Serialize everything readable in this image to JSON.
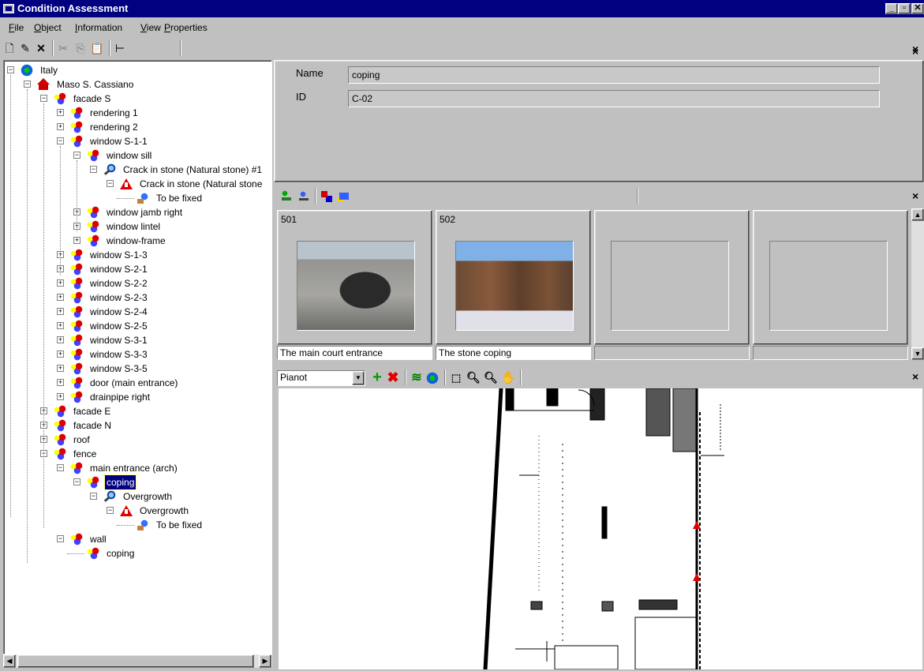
{
  "window": {
    "title": "Condition Assessment"
  },
  "menu": [
    "File",
    "Object",
    "Information",
    "View",
    "Properties"
  ],
  "tree": [
    {
      "label": "Italy",
      "icon": "globe-icon",
      "depth": 0,
      "expander": "minus"
    },
    {
      "label": "Maso S. Cassiano",
      "icon": "house-icon",
      "depth": 1,
      "expander": "minus"
    },
    {
      "label": "facade S",
      "icon": "object-icon",
      "depth": 2,
      "expander": "minus"
    },
    {
      "label": "rendering 1",
      "icon": "object-icon",
      "depth": 3,
      "expander": "plus"
    },
    {
      "label": "rendering 2",
      "icon": "object-icon",
      "depth": 3,
      "expander": "plus"
    },
    {
      "label": "window S-1-1",
      "icon": "object-icon",
      "depth": 3,
      "expander": "minus"
    },
    {
      "label": "window sill",
      "icon": "object-icon",
      "depth": 4,
      "expander": "minus"
    },
    {
      "label": "Crack in stone (Natural stone) #1",
      "icon": "magnifier-icon",
      "depth": 5,
      "expander": "minus"
    },
    {
      "label": "Crack in stone (Natural stone",
      "icon": "warning-icon",
      "depth": 6,
      "expander": "minus"
    },
    {
      "label": "To be fixed",
      "icon": "repair-icon",
      "depth": 7,
      "expander": "none"
    },
    {
      "label": "window jamb right",
      "icon": "object-icon",
      "depth": 4,
      "expander": "plus"
    },
    {
      "label": "window lintel",
      "icon": "object-icon",
      "depth": 4,
      "expander": "plus"
    },
    {
      "label": "window-frame",
      "icon": "object-icon",
      "depth": 4,
      "expander": "plus"
    },
    {
      "label": "window S-1-3",
      "icon": "object-icon",
      "depth": 3,
      "expander": "plus"
    },
    {
      "label": "window S-2-1",
      "icon": "object-icon",
      "depth": 3,
      "expander": "plus"
    },
    {
      "label": "window S-2-2",
      "icon": "object-icon",
      "depth": 3,
      "expander": "plus"
    },
    {
      "label": "window S-2-3",
      "icon": "object-icon",
      "depth": 3,
      "expander": "plus"
    },
    {
      "label": "window S-2-4",
      "icon": "object-icon",
      "depth": 3,
      "expander": "plus"
    },
    {
      "label": "window S-2-5",
      "icon": "object-icon",
      "depth": 3,
      "expander": "plus"
    },
    {
      "label": "window S-3-1",
      "icon": "object-icon",
      "depth": 3,
      "expander": "plus"
    },
    {
      "label": "window S-3-3",
      "icon": "object-icon",
      "depth": 3,
      "expander": "plus"
    },
    {
      "label": "window S-3-5",
      "icon": "object-icon",
      "depth": 3,
      "expander": "plus"
    },
    {
      "label": "door (main entrance)",
      "icon": "object-icon",
      "depth": 3,
      "expander": "plus"
    },
    {
      "label": "drainpipe right",
      "icon": "object-icon",
      "depth": 3,
      "expander": "plus"
    },
    {
      "label": "facade E",
      "icon": "object-icon",
      "depth": 2,
      "expander": "plus"
    },
    {
      "label": "facade N",
      "icon": "object-icon",
      "depth": 2,
      "expander": "plus"
    },
    {
      "label": "roof",
      "icon": "object-icon",
      "depth": 2,
      "expander": "plus"
    },
    {
      "label": "fence",
      "icon": "object-icon",
      "depth": 2,
      "expander": "minus"
    },
    {
      "label": "main entrance (arch)",
      "icon": "object-icon",
      "depth": 3,
      "expander": "minus"
    },
    {
      "label": "coping",
      "icon": "object-icon",
      "depth": 4,
      "expander": "minus",
      "selected": true
    },
    {
      "label": "Overgrowth",
      "icon": "magnifier-icon",
      "depth": 5,
      "expander": "minus"
    },
    {
      "label": "Overgrowth",
      "icon": "warning-icon",
      "depth": 6,
      "expander": "minus"
    },
    {
      "label": "To be fixed",
      "icon": "repair-icon",
      "depth": 7,
      "expander": "none"
    },
    {
      "label": "wall",
      "icon": "object-icon",
      "depth": 3,
      "expander": "minus"
    },
    {
      "label": "coping",
      "icon": "object-icon",
      "depth": 4,
      "expander": "none"
    }
  ],
  "properties": {
    "name_label": "Name",
    "name_value": "coping",
    "id_label": "ID",
    "id_value": "C-02"
  },
  "photos": [
    {
      "number": "501",
      "caption": "The main court entrance",
      "has_image": true
    },
    {
      "number": "502",
      "caption": "The stone coping",
      "has_image": true
    },
    {
      "number": "",
      "caption": "",
      "has_image": false
    },
    {
      "number": "",
      "caption": "",
      "has_image": false
    }
  ],
  "map": {
    "floor": "Pianot"
  },
  "colors": {
    "titlebar": "#000080",
    "face": "#c0c0c0",
    "selection": "#000080",
    "add": "#00a000",
    "delete": "#e00000",
    "marker": "#e00000"
  }
}
